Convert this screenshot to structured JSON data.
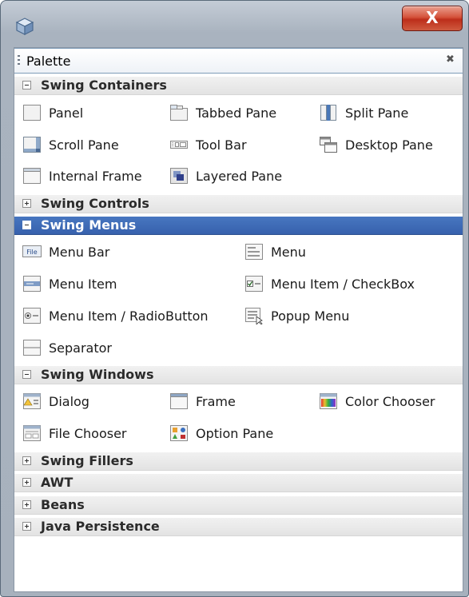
{
  "window": {
    "close_symbol": "X",
    "app_icon": "cube-icon"
  },
  "palette": {
    "title": "Palette",
    "close_symbol": "✖"
  },
  "categories": {
    "containers": {
      "label": "Swing Containers",
      "expanded": true,
      "items": {
        "panel": {
          "label": "Panel",
          "icon": "panel-icon"
        },
        "tabbed_pane": {
          "label": "Tabbed Pane",
          "icon": "tabbed-pane-icon"
        },
        "split_pane": {
          "label": "Split Pane",
          "icon": "split-pane-icon"
        },
        "scroll_pane": {
          "label": "Scroll Pane",
          "icon": "scroll-pane-icon"
        },
        "tool_bar": {
          "label": "Tool Bar",
          "icon": "tool-bar-icon"
        },
        "desktop_pane": {
          "label": "Desktop Pane",
          "icon": "desktop-pane-icon"
        },
        "internal_frame": {
          "label": "Internal Frame",
          "icon": "internal-frame-icon"
        },
        "layered_pane": {
          "label": "Layered Pane",
          "icon": "layered-pane-icon"
        }
      }
    },
    "controls": {
      "label": "Swing Controls",
      "expanded": false
    },
    "menus": {
      "label": "Swing Menus",
      "expanded": true,
      "selected": true,
      "items": {
        "menu_bar": {
          "label": "Menu Bar",
          "icon": "menu-bar-icon",
          "icon_text": "File"
        },
        "menu": {
          "label": "Menu",
          "icon": "menu-icon"
        },
        "menu_item": {
          "label": "Menu Item",
          "icon": "menu-item-icon"
        },
        "menu_item_checkbox": {
          "label": "Menu Item / CheckBox",
          "icon": "menu-item-checkbox-icon"
        },
        "menu_item_radio": {
          "label": "Menu Item / RadioButton",
          "icon": "menu-item-radio-icon"
        },
        "popup_menu": {
          "label": "Popup Menu",
          "icon": "popup-menu-icon"
        },
        "separator": {
          "label": "Separator",
          "icon": "separator-icon"
        }
      }
    },
    "windows": {
      "label": "Swing Windows",
      "expanded": true,
      "items": {
        "dialog": {
          "label": "Dialog",
          "icon": "dialog-icon"
        },
        "frame": {
          "label": "Frame",
          "icon": "frame-icon"
        },
        "color_chooser": {
          "label": "Color Chooser",
          "icon": "color-chooser-icon"
        },
        "file_chooser": {
          "label": "File Chooser",
          "icon": "file-chooser-icon"
        },
        "option_pane": {
          "label": "Option Pane",
          "icon": "option-pane-icon"
        }
      }
    },
    "fillers": {
      "label": "Swing Fillers",
      "expanded": false
    },
    "awt": {
      "label": "AWT",
      "expanded": false
    },
    "beans": {
      "label": "Beans",
      "expanded": false
    },
    "persistence": {
      "label": "Java Persistence",
      "expanded": false
    }
  },
  "colors": {
    "selection": "#3b66b2",
    "close_button": "#c8432b",
    "category_bg": "#e8e8e8"
  }
}
